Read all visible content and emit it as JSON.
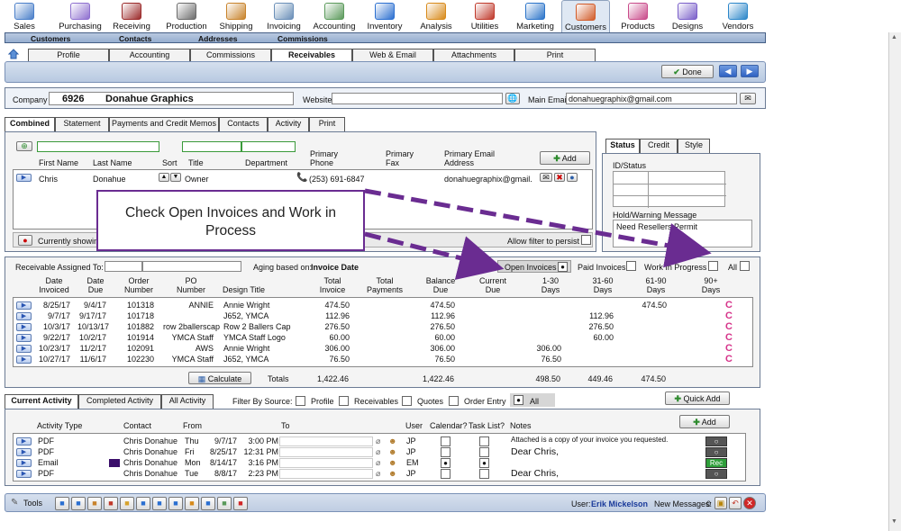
{
  "top_menu": [
    "Sales",
    "Purchasing",
    "Receiving",
    "Production",
    "Shipping",
    "Invoicing",
    "Accounting",
    "Inventory",
    "Analysis",
    "Utilities",
    "Marketing",
    "Customers",
    "Products",
    "Designs",
    "Vendors"
  ],
  "sub_nav": [
    "Customers",
    "Contacts",
    "Addresses",
    "Commissions"
  ],
  "customer_tabs": [
    "Profile",
    "Accounting",
    "Commissions",
    "Receivables",
    "Web & Email",
    "Attachments",
    "Print"
  ],
  "done_label": "Done",
  "company": {
    "label": "Company",
    "number": "6926",
    "name": "Donahue Graphics",
    "website_label": "Website",
    "website": "",
    "email_label": "Main Email",
    "email": "donahuegraphix@gmail.com"
  },
  "section_tabs": [
    "Combined",
    "Statement",
    "Payments and Credit Memos",
    "Contacts",
    "Activity",
    "Print"
  ],
  "contacts": {
    "headers": {
      "first": "First Name",
      "last": "Last Name",
      "sort": "Sort",
      "title": "Title",
      "department": "Department",
      "phone": "Primary Phone",
      "fax": "Primary Fax",
      "email": "Primary Email Address"
    },
    "add_label": "Add",
    "row": {
      "first": "Chris",
      "last": "Donahue",
      "title": "Owner",
      "phone": "(253) 691-6847",
      "email": "donahuegraphix@gmail."
    },
    "currently_showing": "Currently showin",
    "allow_filter": "Allow filter to persist"
  },
  "status_panel": {
    "tabs": [
      "Status",
      "Credit",
      "Style"
    ],
    "id_status": "ID/Status",
    "hold_label": "Hold/Warning Message",
    "hold_text": "Need Resellers Permit"
  },
  "callout": "Check Open Invoices and Work in Process",
  "receivables": {
    "assigned_label": "Receivable Assigned To:",
    "aging_label": "Aging based on:",
    "aging_value": "Invoice Date",
    "filters": {
      "open": "Open Invoices",
      "paid": "Paid Invoices",
      "wip": "Work In Progress",
      "all": "All"
    },
    "headers": {
      "date_inv": "Date Invoiced",
      "date_due": "Date Due",
      "order": "Order Number",
      "po": "PO Number",
      "design": "Design Title",
      "total_inv": "Total Invoice",
      "total_pay": "Total Payments",
      "balance": "Balance Due",
      "current": "Current Due",
      "d1_30": "1-30 Days",
      "d31_60": "31-60 Days",
      "d61_90": "61-90 Days",
      "d90": "90+ Days"
    },
    "rows": [
      {
        "inv": "8/25/17",
        "due": "9/4/17",
        "order": "101318",
        "po": "ANNIE",
        "design": "Annie Wright",
        "total": "474.50",
        "balance": "474.50",
        "d1_30": "",
        "d31_60": "",
        "d61_90": "474.50"
      },
      {
        "inv": "9/7/17",
        "due": "9/17/17",
        "order": "101718",
        "po": "",
        "design": "J652, YMCA",
        "total": "112.96",
        "balance": "112.96",
        "d1_30": "",
        "d31_60": "112.96",
        "d61_90": ""
      },
      {
        "inv": "10/3/17",
        "due": "10/13/17",
        "order": "101882",
        "po": "row 2ballerscap",
        "design": "Row 2 Ballers Cap",
        "total": "276.50",
        "balance": "276.50",
        "d1_30": "",
        "d31_60": "276.50",
        "d61_90": ""
      },
      {
        "inv": "9/22/17",
        "due": "10/2/17",
        "order": "101914",
        "po": "YMCA Staff",
        "design": "YMCA Staff  Logo",
        "total": "60.00",
        "balance": "60.00",
        "d1_30": "",
        "d31_60": "60.00",
        "d61_90": ""
      },
      {
        "inv": "10/23/17",
        "due": "11/2/17",
        "order": "102091",
        "po": "AWS",
        "design": "Annie Wright",
        "total": "306.00",
        "balance": "306.00",
        "d1_30": "306.00",
        "d31_60": "",
        "d61_90": ""
      },
      {
        "inv": "10/27/17",
        "due": "11/6/17",
        "order": "102230",
        "po": "YMCA Staff",
        "design": "J652, YMCA",
        "total": "76.50",
        "balance": "76.50",
        "d1_30": "76.50",
        "d31_60": "",
        "d61_90": ""
      }
    ],
    "calculate_label": "Calculate",
    "totals_label": "Totals",
    "totals": {
      "total": "1,422.46",
      "balance": "1,422.46",
      "d1_30": "498.50",
      "d31_60": "449.46",
      "d61_90": "474.50"
    }
  },
  "activity": {
    "tabs": [
      "Current Activity",
      "Completed Activity",
      "All Activity"
    ],
    "filter_label": "Filter By Source:",
    "sources": [
      "Profile",
      "Receivables",
      "Quotes",
      "Order Entry",
      "All"
    ],
    "quick_add": "Quick Add",
    "add_label": "Add",
    "headers": {
      "type": "Activity Type",
      "contact": "Contact",
      "from": "From",
      "to": "To",
      "user": "User",
      "calendar": "Calendar?",
      "task": "Task List?",
      "notes": "Notes"
    },
    "rows": [
      {
        "type": "PDF",
        "contact": "Chris Donahue",
        "day": "Thu",
        "date": "9/7/17",
        "time": "3:00 PM",
        "user": "JP",
        "cal": "",
        "task": "",
        "note": "Attached is a copy of your invoice you requested."
      },
      {
        "type": "PDF",
        "contact": "Chris Donahue",
        "day": "Fri",
        "date": "8/25/17",
        "time": "12:31 PM",
        "user": "JP",
        "cal": "",
        "task": "",
        "note": "Dear Chris,"
      },
      {
        "type": "Email",
        "contact": "Chris Donahue",
        "day": "Mon",
        "date": "8/14/17",
        "time": "3:16 PM",
        "user": "EM",
        "cal": "●",
        "task": "●",
        "note": ""
      },
      {
        "type": "PDF",
        "contact": "Chris Donahue",
        "day": "Tue",
        "date": "8/8/17",
        "time": "2:23 PM",
        "user": "JP",
        "cal": "",
        "task": "",
        "note": "Dear Chris,"
      }
    ],
    "rec_label": "Rec"
  },
  "footer": {
    "tools": "Tools",
    "user_label": "User:",
    "user": "Erik Mickelson",
    "messages_label": "New Messages:",
    "messages": "0"
  }
}
